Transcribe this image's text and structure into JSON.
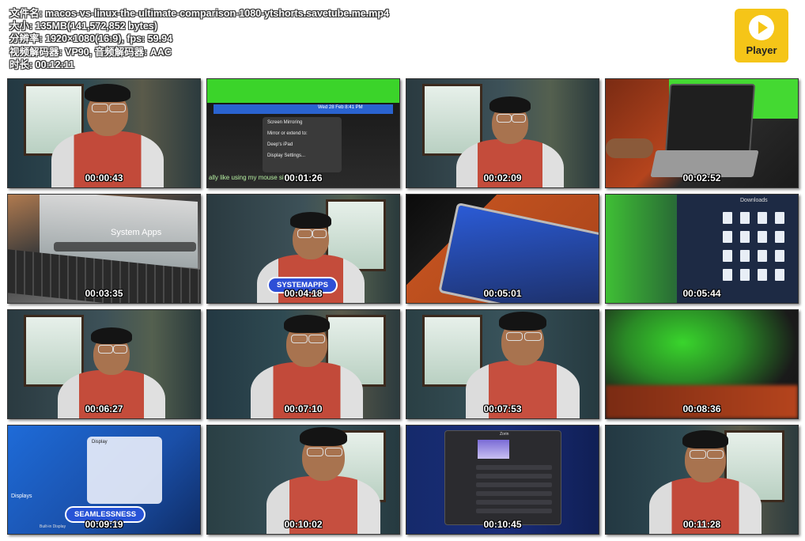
{
  "file_info": {
    "name": "文件名: macos-vs-linux-the-ultimate-comparison-1080-ytshorts.savetube.me.mp4",
    "size": "大小: 135MB(141,572,852 bytes)",
    "resolution": "分辨率: 1920×1080(16:9), fps: 59.94",
    "codecs": "视频解码器: VP90, 音频解码器: AAC",
    "duration": "时长: 00:12:11"
  },
  "player_logo": {
    "label": "Player",
    "icon": "play-icon",
    "color": "#f5c518"
  },
  "thumbnails": [
    {
      "time": "00:00:43",
      "scene": "person"
    },
    {
      "time": "00:01:26",
      "scene": "menu",
      "menu_items": [
        "Screen Mirroring",
        "Wed 28 Feb  8:41 PM",
        "Mirror or extend to:",
        "Deep's iPad",
        "Display Settings...",
        "ally like using my mouse since my"
      ]
    },
    {
      "time": "00:02:09",
      "scene": "person"
    },
    {
      "time": "00:02:52",
      "scene": "laptop"
    },
    {
      "time": "00:03:35",
      "scene": "dock",
      "overlay_text": "System Apps"
    },
    {
      "time": "00:04:18",
      "scene": "person",
      "badge": "SYSTEMAPPS"
    },
    {
      "time": "00:05:01",
      "scene": "laptop-angle"
    },
    {
      "time": "00:05:44",
      "scene": "finder",
      "folder_title": "Downloads"
    },
    {
      "time": "00:06:27",
      "scene": "person"
    },
    {
      "time": "00:07:10",
      "scene": "person"
    },
    {
      "time": "00:07:53",
      "scene": "person"
    },
    {
      "time": "00:08:36",
      "scene": "blur"
    },
    {
      "time": "00:09:19",
      "scene": "display-settings",
      "badge": "SEAMLESSNESS",
      "panel_title": "Display",
      "section_label": "Displays",
      "built_in_label": "Built-in Display"
    },
    {
      "time": "00:10:02",
      "scene": "person"
    },
    {
      "time": "00:10:45",
      "scene": "gnome-settings",
      "window_title": "Zorin"
    },
    {
      "time": "00:11:28",
      "scene": "person"
    }
  ]
}
